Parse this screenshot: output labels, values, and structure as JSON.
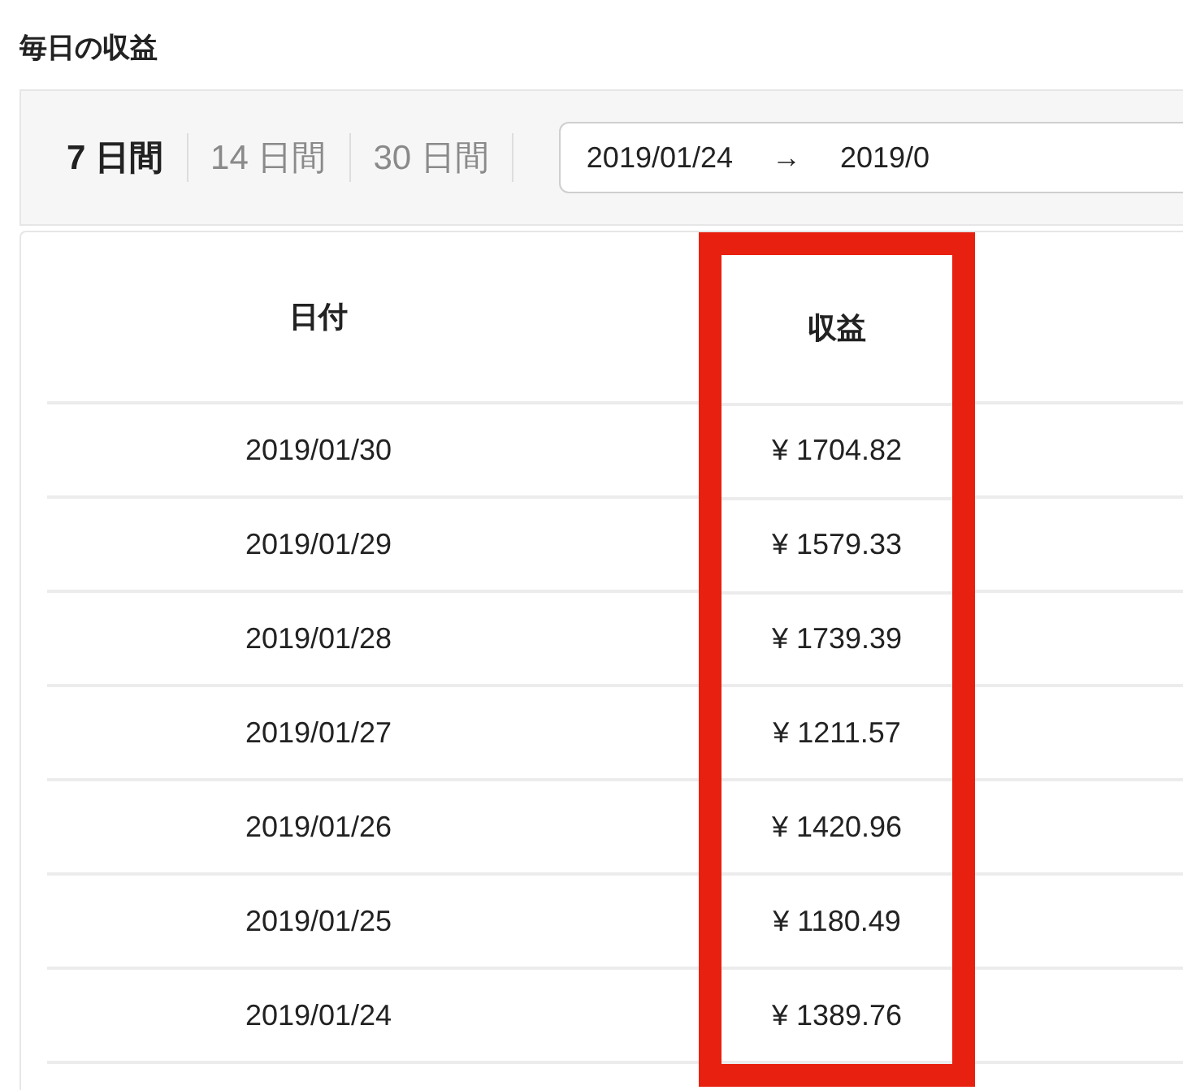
{
  "title": "毎日の収益",
  "period_tabs": [
    {
      "label": "7 日間",
      "selected": true
    },
    {
      "label": "14 日間",
      "selected": false
    },
    {
      "label": "30 日間",
      "selected": false
    }
  ],
  "date_range": {
    "start": "2019/01/24",
    "arrow": "→",
    "end": "2019/0"
  },
  "table": {
    "columns": [
      {
        "header": "日付",
        "highlighted": false
      },
      {
        "header": "収益",
        "highlighted": true
      }
    ],
    "rows": [
      {
        "date": "2019/01/30",
        "revenue": "¥ 1704.82"
      },
      {
        "date": "2019/01/29",
        "revenue": "¥ 1579.33"
      },
      {
        "date": "2019/01/28",
        "revenue": "¥ 1739.39"
      },
      {
        "date": "2019/01/27",
        "revenue": "¥ 1211.57"
      },
      {
        "date": "2019/01/26",
        "revenue": "¥ 1420.96"
      },
      {
        "date": "2019/01/25",
        "revenue": "¥ 1180.49"
      },
      {
        "date": "2019/01/24",
        "revenue": "¥ 1389.76"
      }
    ]
  }
}
